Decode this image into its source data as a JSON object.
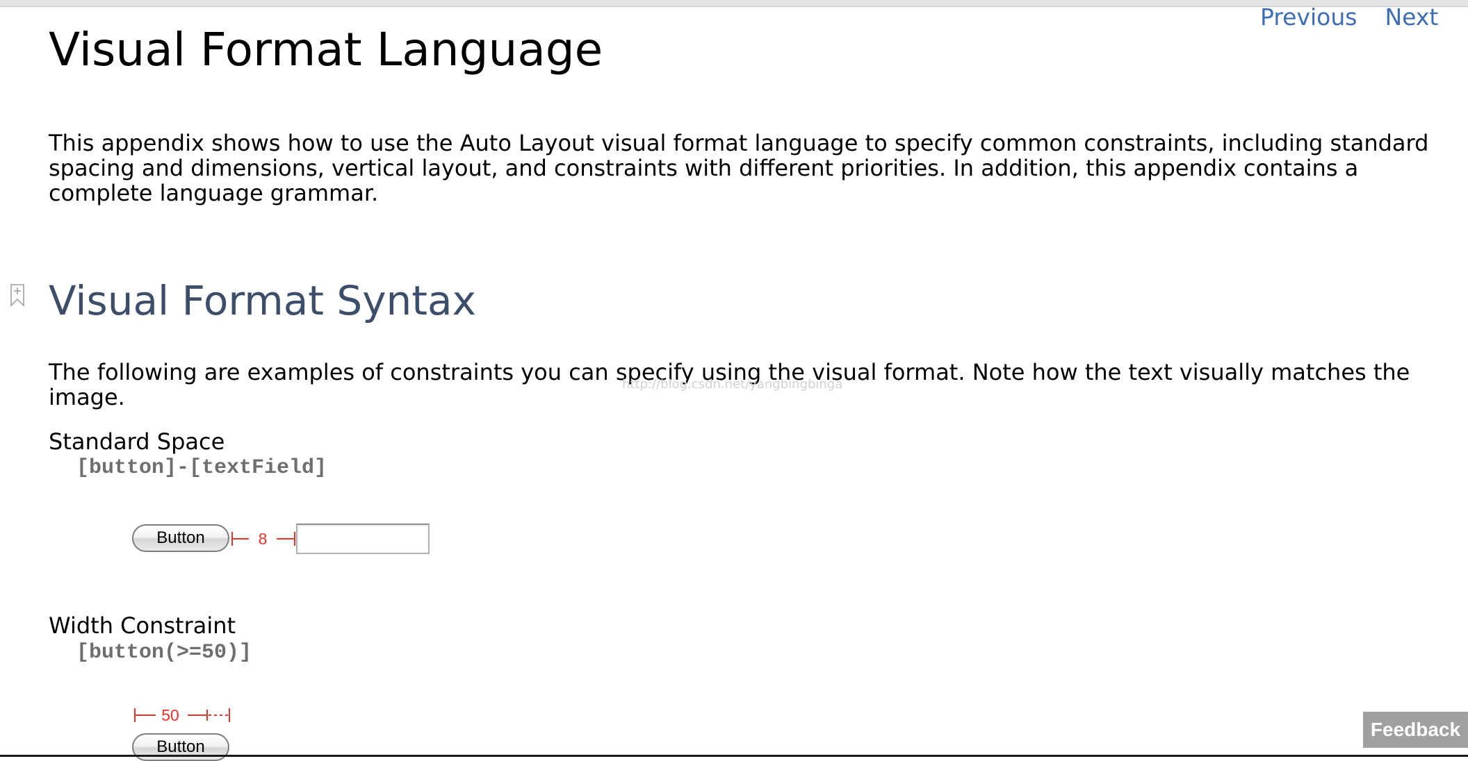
{
  "nav": {
    "previous_label": "Previous",
    "next_label": "Next",
    "link_color": "#3d6db5"
  },
  "page": {
    "title": "Visual Format Language",
    "intro": "This appendix shows how to use the Auto Layout visual format language to specify common constraints, including standard spacing and dimensions, vertical layout, and constraints with different priorities. In addition, this appendix contains a complete language grammar."
  },
  "syntax": {
    "heading": "Visual Format Syntax",
    "heading_color": "#3d4e6b",
    "lead": "The following are examples of constraints you can specify using the visual format. Note how the text visually matches the image.",
    "watermark": "http://blog.csdn.net/yangbingbinga"
  },
  "examples": {
    "standard_space": {
      "title": "Standard Space",
      "code": "[button]-[textField]",
      "button_label": "Button",
      "spacing_label": "8"
    },
    "width_constraint": {
      "title": "Width Constraint",
      "code": "[button(>=50)]",
      "button_label": "Button",
      "width_label": "50"
    }
  },
  "icons": {
    "bookmark": "bookmark-add-icon"
  },
  "colors": {
    "measure_red": "#e8332a",
    "code_gray": "#6e6e6e"
  },
  "feedback": {
    "label": "Feedback"
  }
}
